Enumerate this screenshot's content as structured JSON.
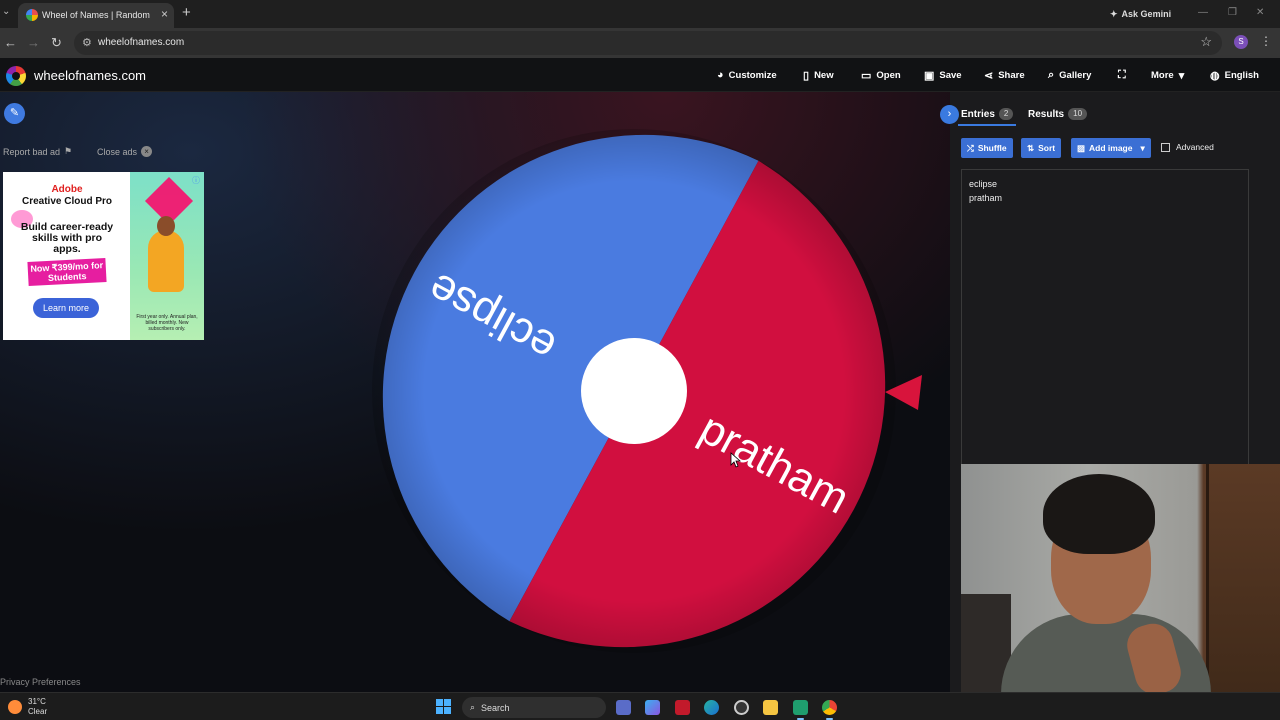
{
  "browser": {
    "tab_title": "Wheel of Names | Random name picker",
    "url": "wheelofnames.com",
    "ask_gemini": "Ask Gemini",
    "profile_initial": "S"
  },
  "site": {
    "name": "wheelofnames.com",
    "menu": [
      {
        "label": "Customize",
        "icon": "palette-icon"
      },
      {
        "label": "New",
        "icon": "file-icon"
      },
      {
        "label": "Open",
        "icon": "folder-icon"
      },
      {
        "label": "Save",
        "icon": "save-icon"
      },
      {
        "label": "Share",
        "icon": "share-icon"
      },
      {
        "label": "Gallery",
        "icon": "search-icon"
      },
      {
        "label": "",
        "icon": "fullscreen-icon"
      },
      {
        "label": "More",
        "icon": "chevron-down-icon"
      },
      {
        "label": "English",
        "icon": "globe-icon"
      }
    ]
  },
  "ads": {
    "report": "Report bad ad",
    "close": "Close ads",
    "brand_line1": "Adobe",
    "brand_line2": "Creative Cloud Pro",
    "headline": "Build career-ready skills with pro apps.",
    "offer": "Now ₹399/mo for Students",
    "cta": "Learn more",
    "fine_print": "First year only. Annual plan, billed monthly. New subscribers only."
  },
  "wheel": {
    "segments": [
      {
        "name": "eclipse",
        "color": "#4a7be0"
      },
      {
        "name": "pratham",
        "color": "#d10f3f"
      }
    ],
    "pointer_color": "#d8143c"
  },
  "panel": {
    "tabs": [
      {
        "label": "Entries",
        "count": "2"
      },
      {
        "label": "Results",
        "count": "10"
      }
    ],
    "buttons": {
      "shuffle": "Shuffle",
      "sort": "Sort",
      "add_image": "Add image",
      "advanced": "Advanced"
    },
    "entries": [
      "eclipse",
      "pratham"
    ]
  },
  "footer": {
    "privacy": "Privacy Preferences"
  },
  "taskbar": {
    "temp": "31°C",
    "condition": "Clear",
    "search": "Search"
  }
}
